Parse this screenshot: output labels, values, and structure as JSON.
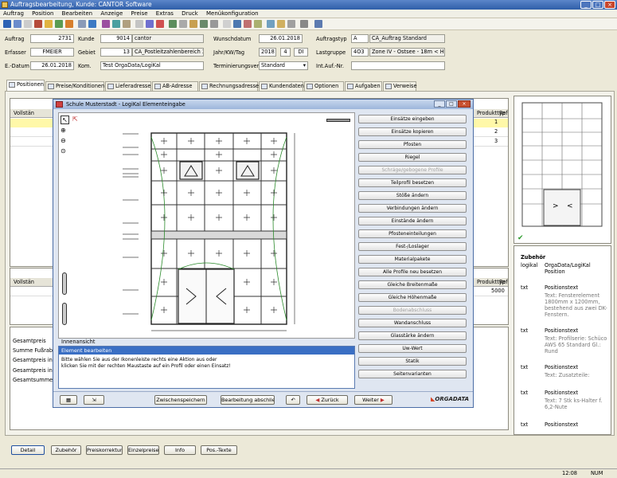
{
  "window": {
    "title": "Auftragsbearbeitung, Kunde: CANTOR Software"
  },
  "menu": [
    "Auftrag",
    "Position",
    "Bearbeiten",
    "Anzeige",
    "Preise",
    "Extras",
    "Druck",
    "Menükonfiguration"
  ],
  "header": {
    "auftrag_label": "Auftrag",
    "auftrag_value": "2731",
    "kunde_label": "Kunde",
    "kunde_number": "9014",
    "kunde_name": "cantor",
    "wunschdatum_label": "Wunschdatum",
    "wunschdatum_value": "26.01.2018",
    "auftragstyp_label": "Auftragstyp",
    "auftragstyp_code": "A",
    "auftragstyp_name": "CA_Auftrag Standard",
    "erfasser_label": "Erfasser",
    "erfasser_value": "FMEIER",
    "gebiet_label": "Gebiet",
    "gebiet_number": "13",
    "gebiet_name": "CA_Postleitzahlenbereich 3...",
    "jahr_label": "Jahr/KW/Tag",
    "jahr_value": "2018",
    "kw_value": "4",
    "tag_value": "DI",
    "lastgruppe_label": "Lastgruppe",
    "lastgruppe_code": "4O3",
    "lastgruppe_name": "Zone IV - Ostsee - 18m < Höhe",
    "edatum_label": "E.-Datum",
    "edatum_value": "26.01.2018",
    "kom_label": "Kom.",
    "kom_value": "Test OrgaData/LogiKal",
    "termin_label": "Terminierungsverf.",
    "termin_value": "Standard",
    "intauf_label": "Int.Auf.-Nr."
  },
  "tabs": [
    "Positionen",
    "Preise/Konditionen",
    "Lieferadresse",
    "AB-Adresse",
    "Rechnungsadresse",
    "Kundendaten",
    "Optionen",
    "Aufgaben",
    "Verweise"
  ],
  "positions": {
    "col_vollstaen": "Vollstän",
    "col_typ": "Produkttyp",
    "col_ref": "Ref",
    "refs": [
      "1",
      "2",
      "3"
    ]
  },
  "lower_grid": {
    "col_vollstaen": "Vollstän",
    "col_typ": "Produkttyp",
    "col_ref": "Ref",
    "ref_value": "5000"
  },
  "totals": [
    "Gesamtpreis",
    "Summe Fußraba",
    "Gesamtpreis ink",
    "Gesamtpreis ink",
    "Gesamtsumme N"
  ],
  "dialog": {
    "title": "Schule Musterstadt - LogiKal Elementeingabe",
    "view_label": "Innenansicht",
    "panel_header": "Element bearbeiten",
    "help_text_1": "Bitte wählen Sie aus der Ikonenleiste rechts eine Aktion aus oder",
    "help_text_2": "klicken Sie mit der rechten Maustaste auf ein Profil oder einen Einsatz!",
    "actions": [
      {
        "label": "Einsätze eingeben",
        "enabled": true
      },
      {
        "label": "Einsätze kopieren",
        "enabled": true
      },
      {
        "label": "Pfosten",
        "enabled": true
      },
      {
        "label": "Riegel",
        "enabled": true
      },
      {
        "label": "Schräge/gebogene Profile",
        "enabled": false
      },
      {
        "label": "Teilprofil besetzen",
        "enabled": true
      },
      {
        "label": "Stöße ändern",
        "enabled": true
      },
      {
        "label": "Verbindungen ändern",
        "enabled": true
      },
      {
        "label": "Einstände ändern",
        "enabled": true
      },
      {
        "label": "Pfosteneinteilungen",
        "enabled": true
      },
      {
        "label": "Fest-/Loslager",
        "enabled": true
      },
      {
        "label": "Materialpakete",
        "enabled": true
      },
      {
        "label": "Alle Profile neu besetzen",
        "enabled": true
      },
      {
        "label": "Gleiche Breitenmaße",
        "enabled": true
      },
      {
        "label": "Gleiche Höhenmaße",
        "enabled": true
      },
      {
        "label": "Bodenabschluss",
        "enabled": false
      },
      {
        "label": "Wandanschluss",
        "enabled": true
      },
      {
        "label": "Glasstärke ändern",
        "enabled": true
      },
      {
        "label": "Uw-Wert",
        "enabled": true
      },
      {
        "label": "Statik",
        "enabled": true
      },
      {
        "label": "Seitenvarianten",
        "enabled": true
      }
    ],
    "footer": {
      "zwischenspeichern": "Zwischenspeichern",
      "abschliessen": "Bearbeitung abschließen",
      "zurueck": "Zurück",
      "weiter": "Weiter",
      "brand": "ORGADATA"
    }
  },
  "right_panel": {
    "header_title": "Zubehör",
    "header_sub1": "logikal",
    "header_sub2": "OrgaData/LogiKal Position",
    "items": [
      {
        "type": "txt",
        "title": "Positionstext",
        "detail": "Text: Fensterelement 1800mm x 1200mm, bestehend aus zwei DK-Fenstern."
      },
      {
        "type": "txt",
        "title": "Positionstext",
        "detail": "Text: Profilserie: Schüco AWS 65 Standard Gl.: Rund"
      },
      {
        "type": "txt",
        "title": "Positionstext",
        "detail": "Text: Zusatzteile:"
      },
      {
        "type": "txt",
        "title": "Positionstext",
        "detail": "Text: 7 Stk ks-Halter f. 6,2-Nute"
      },
      {
        "type": "txt",
        "title": "Positionstext",
        "detail": ""
      }
    ]
  },
  "bottom_buttons": [
    "Detail",
    "Zubehör",
    "Preiskorrektur",
    "Einzelpreise",
    "Info",
    "Pos.-Texte"
  ],
  "status": {
    "time": "12:08",
    "mode": "NUM"
  },
  "colors": {
    "titlebar": "#2f5ea8",
    "dialog_header": "#3a6fc4",
    "selection": "#fff8a8"
  }
}
